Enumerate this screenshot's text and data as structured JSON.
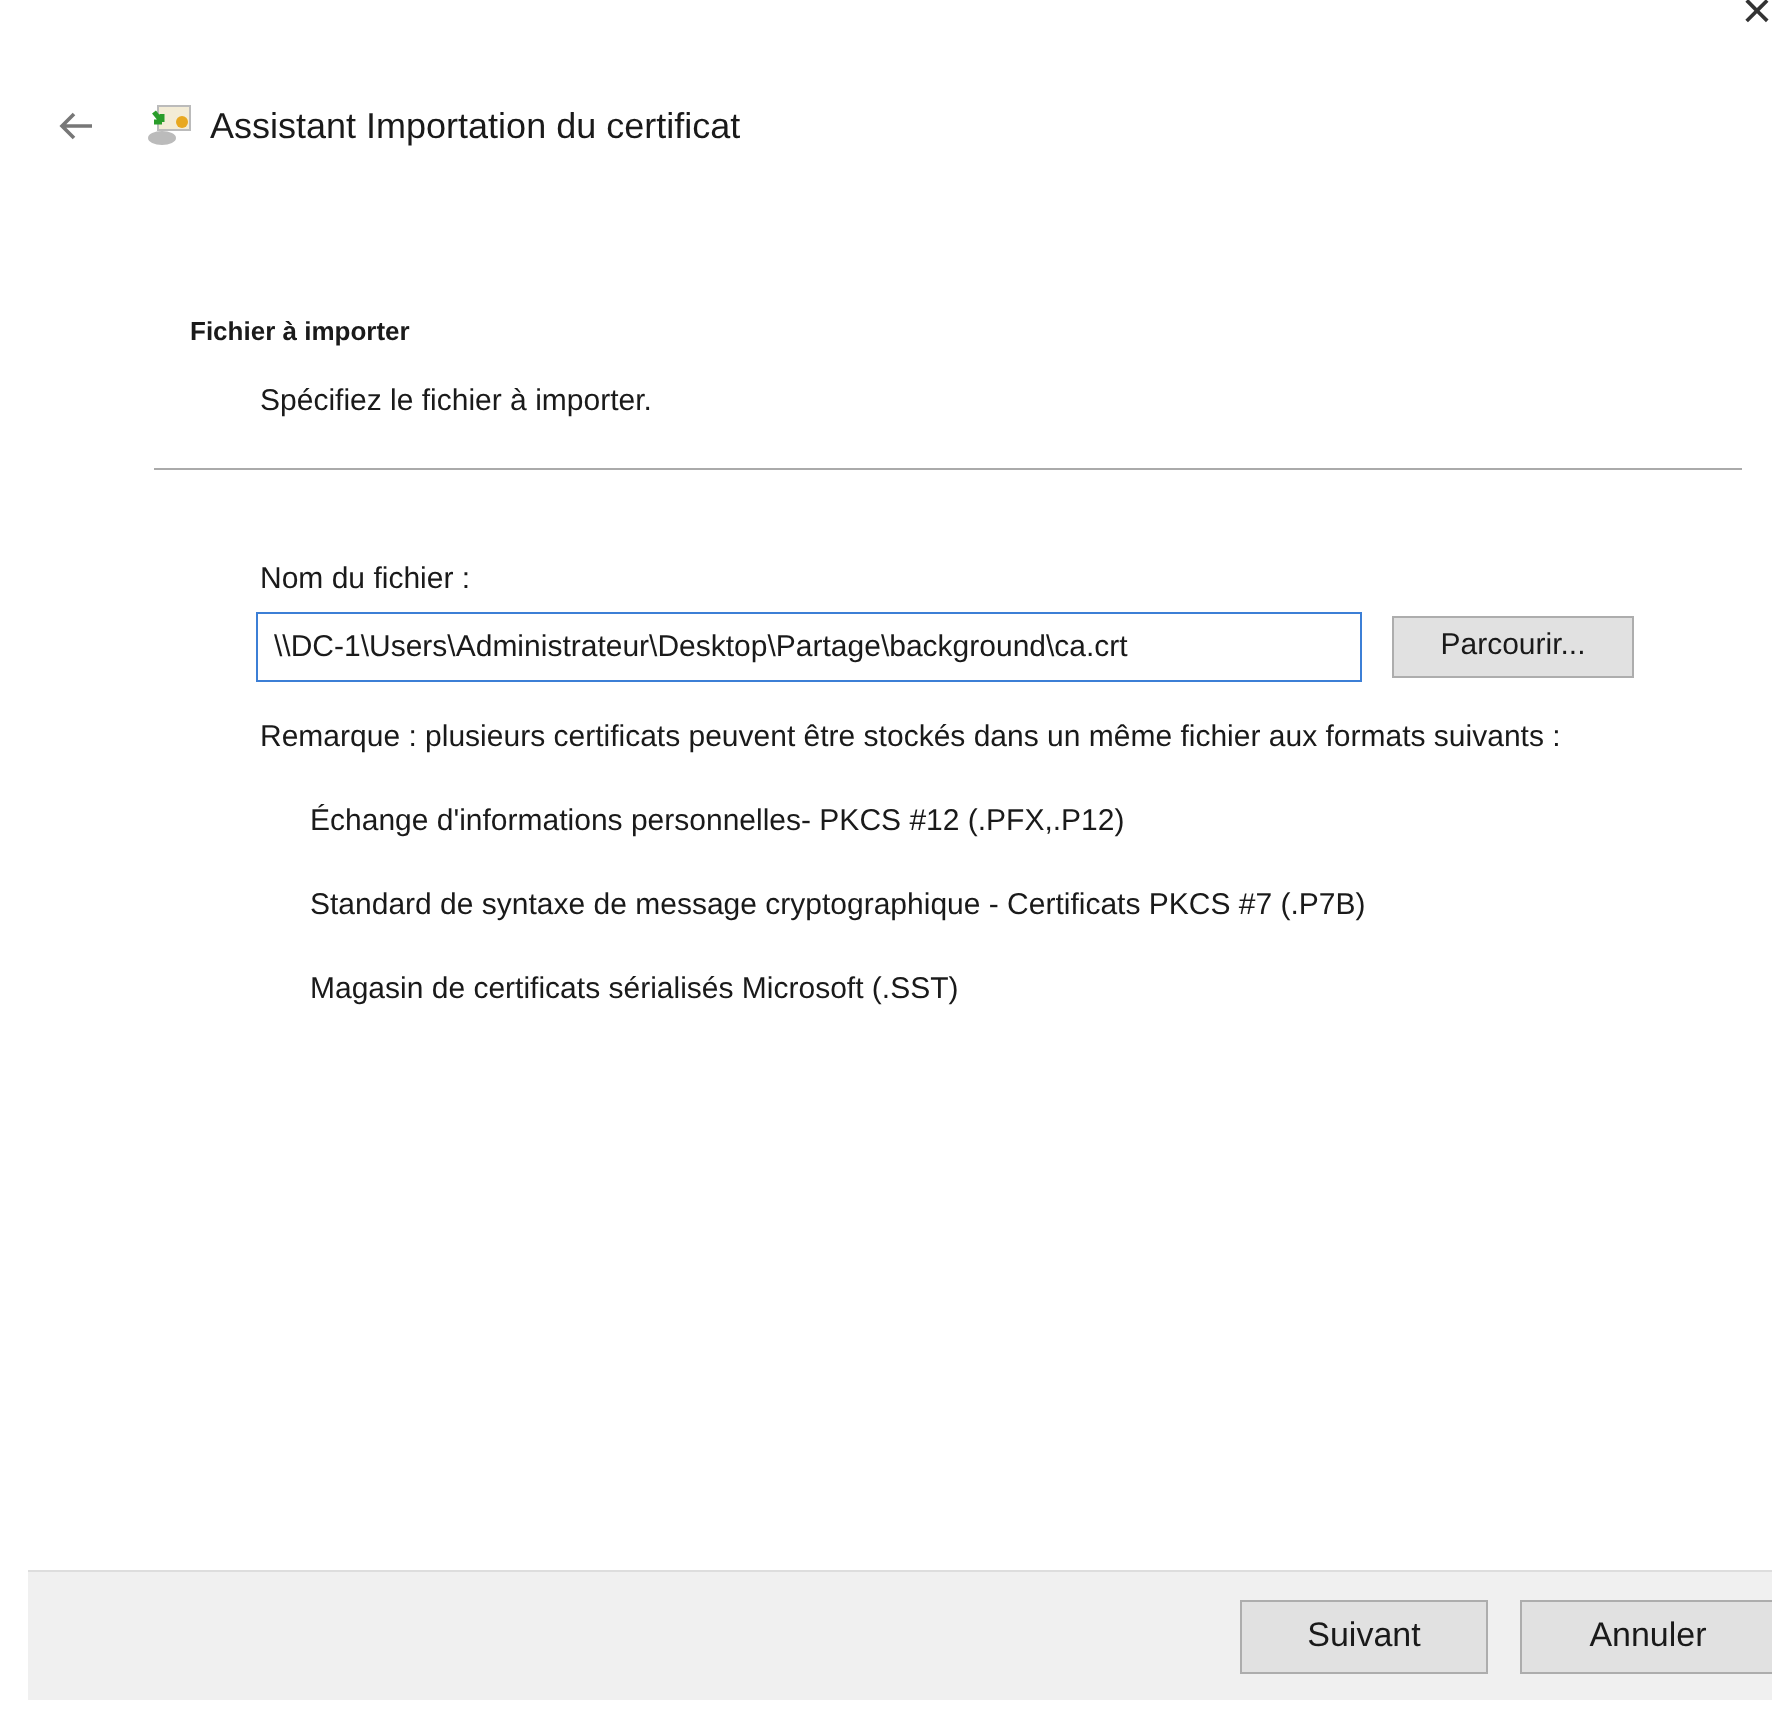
{
  "window": {
    "title": "Assistant Importation du certificat",
    "close": "×"
  },
  "section": {
    "heading": "Fichier à importer",
    "description": "Spécifiez le fichier à importer."
  },
  "file_field": {
    "label": "Nom du fichier :",
    "value": "\\\\DC-1\\Users\\Administrateur\\Desktop\\Partage\\background\\ca.crt",
    "focused": true
  },
  "browse_button": "Parcourir...",
  "note": "Remarque : plusieurs certificats peuvent être stockés dans un même fichier aux formats suivants :",
  "formats": [
    "Échange d'informations personnelles- PKCS #12 (.PFX,.P12)",
    "Standard de syntaxe de message cryptographique - Certificats PKCS #7 (.P7B)",
    "Magasin de certificats sérialisés Microsoft (.SST)"
  ],
  "buttons": [
    {
      "label": "Suivant",
      "kind": "primary"
    },
    {
      "label": "Annuler",
      "kind": "cancel"
    }
  ]
}
